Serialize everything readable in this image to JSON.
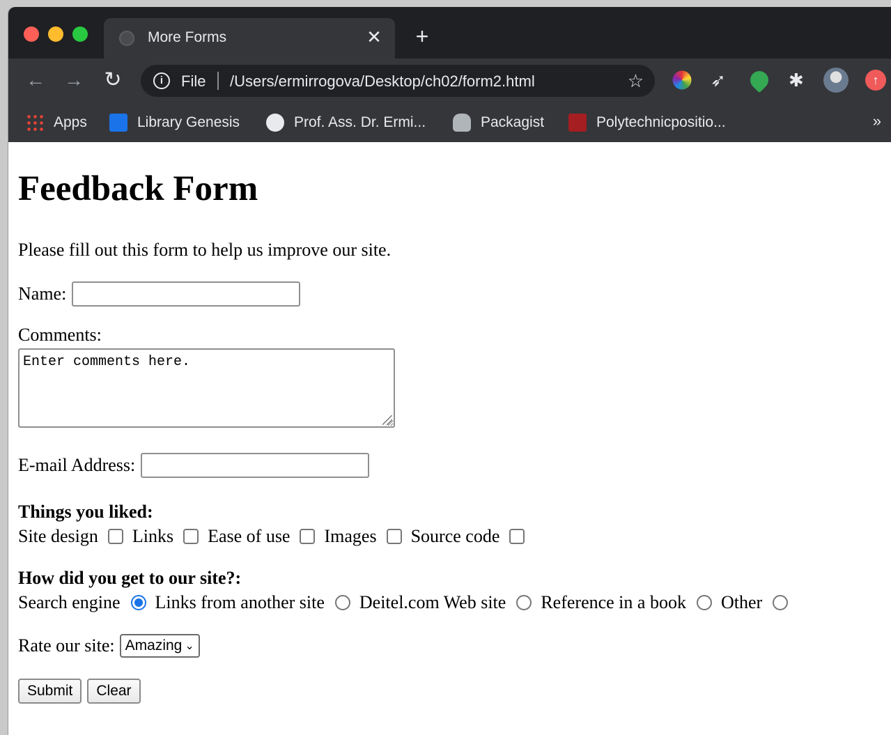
{
  "browser": {
    "tab_title": "More Forms",
    "new_tab_label": "+",
    "close_tab_label": "✕",
    "file_label": "File",
    "url": "/Users/ermirrogova/Desktop/ch02/form2.html",
    "bookmarks": [
      {
        "label": "Apps",
        "icon": "apps-grid-icon"
      },
      {
        "label": "Library Genesis",
        "icon": "library-genesis-icon"
      },
      {
        "label": "Prof. Ass. Dr. Ermi...",
        "icon": "globe-icon"
      },
      {
        "label": "Packagist",
        "icon": "packagist-icon"
      },
      {
        "label": "Polytechnicpositio...",
        "icon": "polytechnic-icon"
      }
    ],
    "bookmarks_overflow": "»"
  },
  "form": {
    "title": "Feedback Form",
    "intro": "Please fill out this form to help us improve our site.",
    "name_label": "Name:",
    "name_value": "",
    "comments_label": "Comments:",
    "comments_value": "Enter comments here.",
    "email_label": "E-mail Address:",
    "email_value": "",
    "liked_heading": "Things you liked:",
    "liked_options": [
      {
        "label": "Site design",
        "checked": false
      },
      {
        "label": "Links",
        "checked": false
      },
      {
        "label": "Ease of use",
        "checked": false
      },
      {
        "label": "Images",
        "checked": false
      },
      {
        "label": "Source code",
        "checked": false
      }
    ],
    "source_heading": "How did you get to our site?:",
    "source_options": [
      {
        "label": "Search engine",
        "checked": true
      },
      {
        "label": "Links from another site",
        "checked": false
      },
      {
        "label": "Deitel.com Web site",
        "checked": false
      },
      {
        "label": "Reference in a book",
        "checked": false
      },
      {
        "label": "Other",
        "checked": false
      }
    ],
    "rate_label": "Rate our site:",
    "rate_value": "Amazing",
    "submit_label": "Submit",
    "clear_label": "Clear"
  }
}
